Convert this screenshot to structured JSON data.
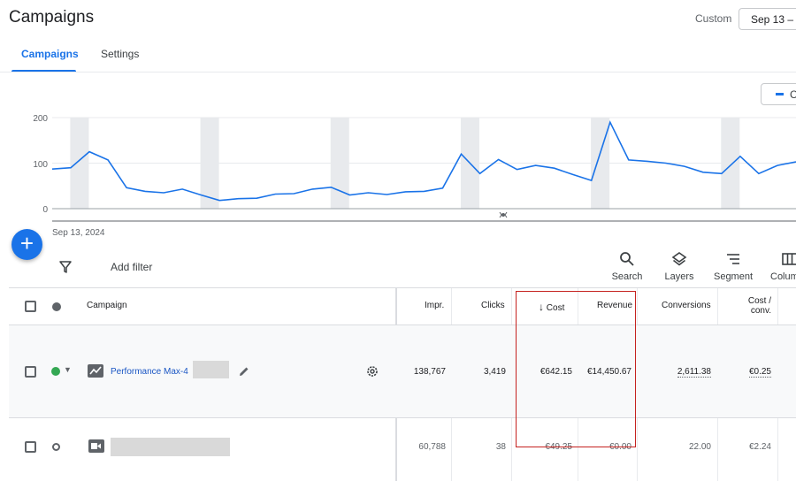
{
  "header": {
    "title": "Campaigns",
    "date_label": "Custom",
    "date_value": "Sep 13 –"
  },
  "tabs": [
    {
      "label": "Campaigns",
      "active": true
    },
    {
      "label": "Settings",
      "active": false
    }
  ],
  "legend": {
    "label": "C",
    "color": "#1a73e8"
  },
  "chart_data": {
    "type": "line",
    "y_ticks": [
      "200",
      "100",
      "0"
    ],
    "ylim": [
      0,
      200
    ],
    "x_start_label": "Sep 13, 2024",
    "grid": true,
    "series": [
      {
        "color": "#1a73e8",
        "values": [
          87,
          90,
          125,
          107,
          46,
          38,
          35,
          43,
          30,
          18,
          22,
          23,
          32,
          33,
          43,
          47,
          30,
          35,
          31,
          37,
          38,
          45,
          120,
          77,
          108,
          86,
          95,
          89,
          75,
          62,
          190,
          107,
          104,
          100,
          93,
          80,
          77,
          115,
          77,
          95,
          103
        ]
      }
    ]
  },
  "toolbar": {
    "add_filter": "Add filter",
    "tools": [
      {
        "label": "Search",
        "icon": "search-icon"
      },
      {
        "label": "Layers",
        "icon": "layers-icon"
      },
      {
        "label": "Segment",
        "icon": "segment-icon"
      },
      {
        "label": "Colum",
        "icon": "columns-icon"
      }
    ]
  },
  "table": {
    "columns": {
      "campaign": "Campaign",
      "impr": "Impr.",
      "clicks": "Clicks",
      "cost": "Cost",
      "revenue": "Revenue",
      "conversions": "Conversions",
      "cost_conv_1": "Cost /",
      "cost_conv_2": "conv."
    },
    "rows": [
      {
        "name": "Performance Max-4",
        "status_color": "#34a853",
        "impr": "138,767",
        "clicks": "3,419",
        "cost": "€642.15",
        "revenue": "€14,450.67",
        "conversions": "2,611.38",
        "cost_conv": "€0.25"
      },
      {
        "name": "",
        "status_color": "#5f6368",
        "impr": "60,788",
        "clicks": "38",
        "cost": "€49.25",
        "revenue": "€0.00",
        "conversions": "22.00",
        "cost_conv": "€2.24"
      }
    ]
  }
}
